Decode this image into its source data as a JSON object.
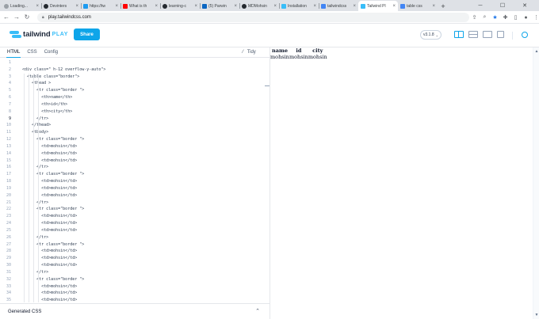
{
  "browser": {
    "tabs": [
      {
        "title": "Loading...",
        "icon": "loading-icon",
        "color": "#9aa0a6"
      },
      {
        "title": "Devinters",
        "icon": "github-icon",
        "color": "#24292f"
      },
      {
        "title": "https://tw",
        "icon": "twitter-icon",
        "color": "#1d9bf0"
      },
      {
        "title": "What is th",
        "icon": "youtube-icon",
        "color": "#ff0000"
      },
      {
        "title": "learning-c",
        "icon": "github-icon",
        "color": "#24292f"
      },
      {
        "title": "(5) Parwin",
        "icon": "linkedin-icon",
        "color": "#0a66c2"
      },
      {
        "title": "MDMohsin",
        "icon": "github-icon",
        "color": "#24292f"
      },
      {
        "title": "Installation",
        "icon": "tailwind-icon",
        "color": "#38bdf8"
      },
      {
        "title": "tailwindcss",
        "icon": "google-icon",
        "color": "#4285f4"
      },
      {
        "title": "Tailwind Pl",
        "icon": "tailwind-icon",
        "color": "#38bdf8"
      },
      {
        "title": "table css",
        "icon": "google-icon",
        "color": "#4285f4"
      }
    ],
    "active_tab": 9,
    "new_tab_label": "+",
    "url": "play.tailwindcss.com"
  },
  "play": {
    "brand": "tailwind",
    "brand_suffix": "PLAY",
    "share_label": "Share",
    "version": "v3.1.8",
    "editor_tabs": [
      "HTML",
      "CSS",
      "Config"
    ],
    "tidy_label": "Tidy",
    "generated_css_label": "Generated CSS",
    "active_line": 9
  },
  "code_lines": [
    "",
    "<div class=\" h-12 overflow-y-auto\">",
    "  <table class=\"border\">",
    "    <thead >",
    "      <tr class=\"border \">",
    "        <th>name</th>",
    "        <th>id</th>",
    "        <th>city</th>",
    "      </tr>",
    "    </thead>",
    "    <tbody>",
    "      <tr class=\"border \">",
    "        <td>mohsin</td>",
    "        <td>mohsin</td>",
    "        <td>mohsin</td>",
    "      </tr>",
    "      <tr class=\"border \">",
    "        <td>mohsin</td>",
    "        <td>mohsin</td>",
    "        <td>mohsin</td>",
    "      </tr>",
    "      <tr class=\"border \">",
    "        <td>mohsin</td>",
    "        <td>mohsin</td>",
    "        <td>mohsin</td>",
    "      </tr>",
    "      <tr class=\"border \">",
    "        <td>mohsin</td>",
    "        <td>mohsin</td>",
    "        <td>mohsin</td>",
    "      </tr>",
    "      <tr class=\"border \">",
    "        <td>mohsin</td>",
    "        <td>mohsin</td>",
    "        <td>mohsin</td>"
  ],
  "preview": {
    "headers": [
      "name",
      "id",
      "city"
    ],
    "rows": [
      [
        "mohsin",
        "mohsin",
        "mohsin"
      ]
    ]
  }
}
